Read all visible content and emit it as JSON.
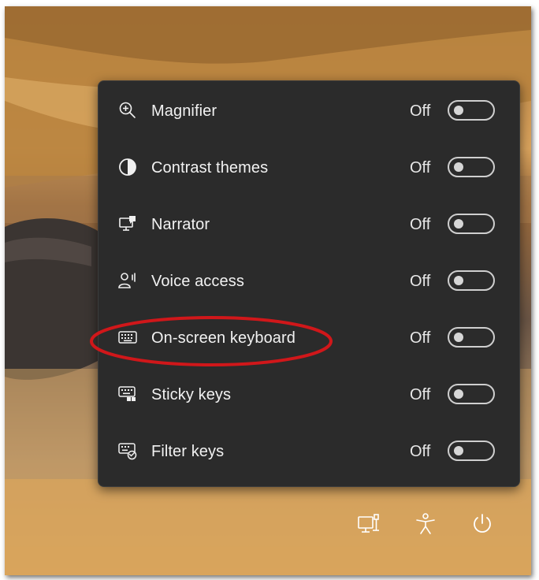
{
  "accessibility_menu": {
    "items": [
      {
        "label": "Magnifier",
        "state": "Off",
        "icon": "magnifier-icon"
      },
      {
        "label": "Contrast themes",
        "state": "Off",
        "icon": "contrast-icon"
      },
      {
        "label": "Narrator",
        "state": "Off",
        "icon": "narrator-icon"
      },
      {
        "label": "Voice access",
        "state": "Off",
        "icon": "voice-access-icon"
      },
      {
        "label": "On-screen keyboard",
        "state": "Off",
        "icon": "keyboard-icon"
      },
      {
        "label": "Sticky keys",
        "state": "Off",
        "icon": "sticky-keys-icon"
      },
      {
        "label": "Filter keys",
        "state": "Off",
        "icon": "filter-keys-icon"
      }
    ]
  },
  "bottom_bar": {
    "icons": [
      "network-icon",
      "accessibility-icon",
      "power-icon"
    ]
  },
  "colors": {
    "panel_bg": "#2b2b2b",
    "text": "#f2f2f2",
    "annotation": "#d0171a"
  }
}
